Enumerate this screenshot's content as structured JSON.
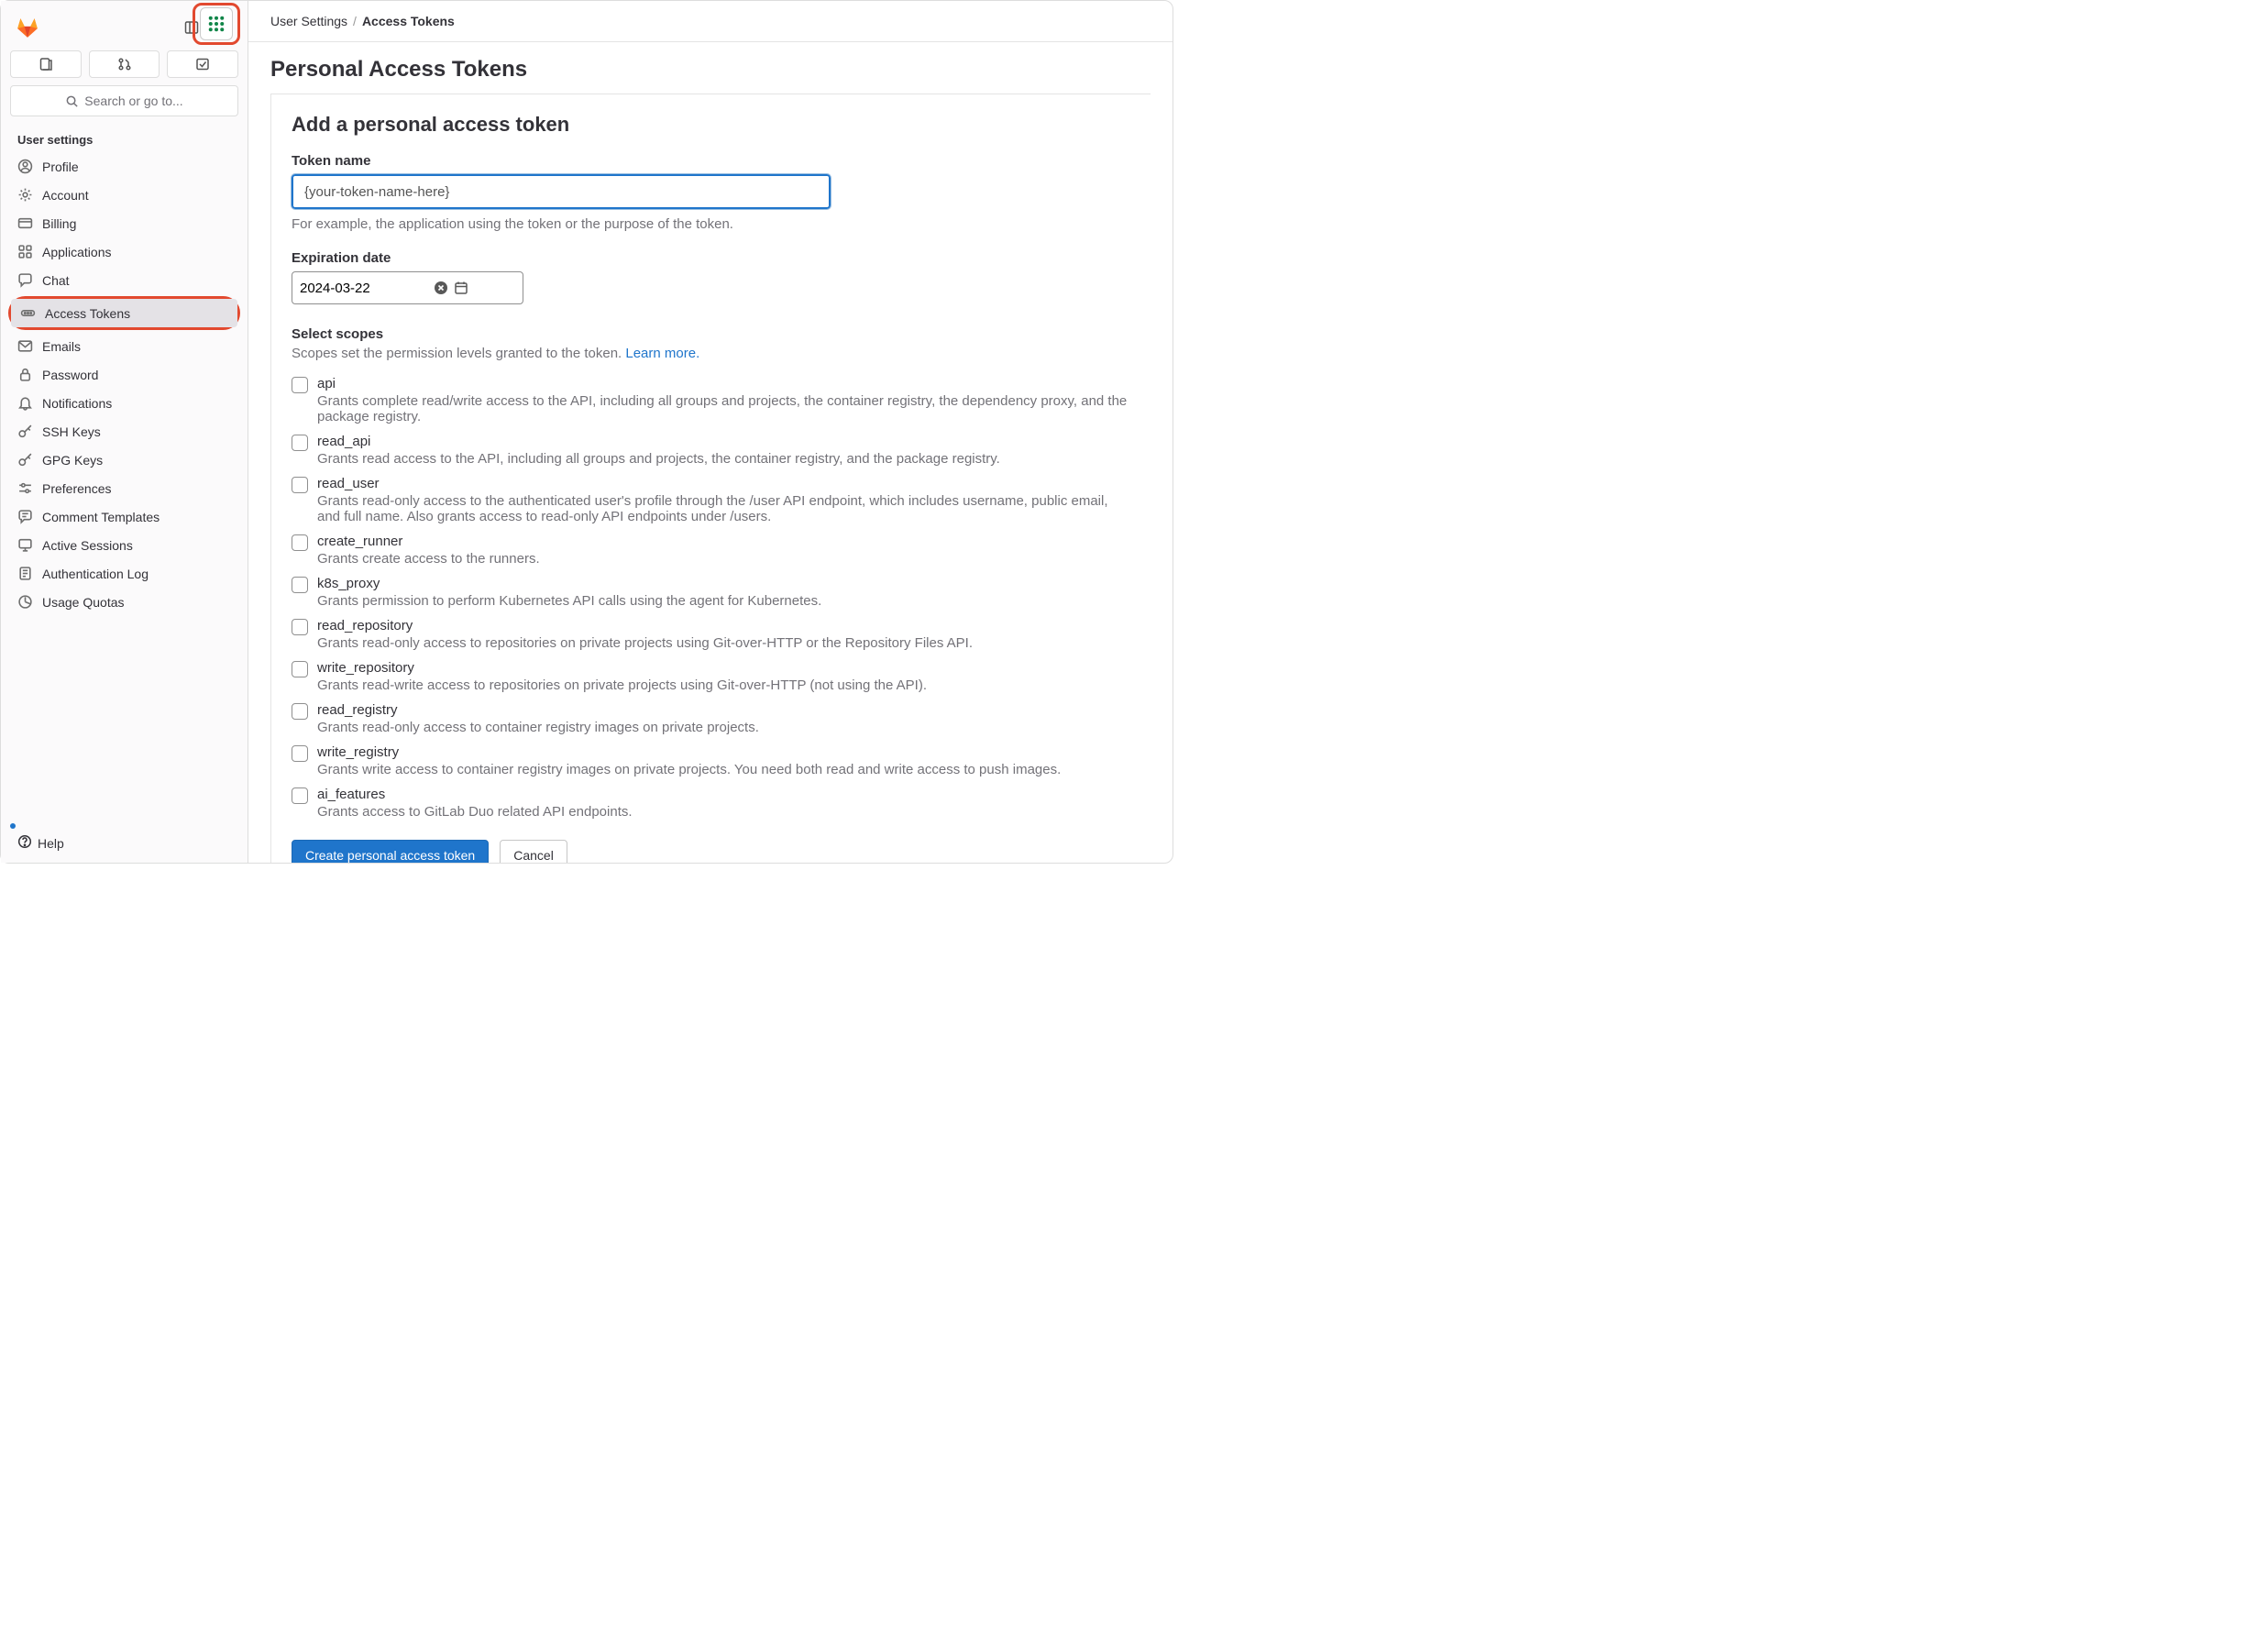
{
  "sidebar": {
    "search_placeholder": "Search or go to...",
    "section_label": "User settings",
    "nav_items": [
      {
        "label": "Profile",
        "icon": "profile-icon"
      },
      {
        "label": "Account",
        "icon": "gear-icon"
      },
      {
        "label": "Billing",
        "icon": "credit-card-icon"
      },
      {
        "label": "Applications",
        "icon": "applications-icon"
      },
      {
        "label": "Chat",
        "icon": "chat-icon"
      },
      {
        "label": "Access Tokens",
        "icon": "token-icon"
      },
      {
        "label": "Emails",
        "icon": "mail-icon"
      },
      {
        "label": "Password",
        "icon": "lock-icon"
      },
      {
        "label": "Notifications",
        "icon": "bell-icon"
      },
      {
        "label": "SSH Keys",
        "icon": "key-icon"
      },
      {
        "label": "GPG Keys",
        "icon": "key-icon"
      },
      {
        "label": "Preferences",
        "icon": "preferences-icon"
      },
      {
        "label": "Comment Templates",
        "icon": "comment-template-icon"
      },
      {
        "label": "Active Sessions",
        "icon": "monitor-icon"
      },
      {
        "label": "Authentication Log",
        "icon": "log-icon"
      },
      {
        "label": "Usage Quotas",
        "icon": "quota-icon"
      }
    ],
    "help_label": "Help"
  },
  "breadcrumb": {
    "root": "User Settings",
    "sep": "/",
    "current": "Access Tokens"
  },
  "page": {
    "title": "Personal Access Tokens",
    "form_heading": "Add a personal access token",
    "token_name_label": "Token name",
    "token_name_value": "{your-token-name-here}",
    "token_name_help": "For example, the application using the token or the purpose of the token.",
    "expiration_label": "Expiration date",
    "expiration_value": "2024-03-22",
    "scopes_label": "Select scopes",
    "scopes_help": "Scopes set the permission levels granted to the token. ",
    "scopes_learn_more": "Learn more.",
    "create_button": "Create personal access token",
    "cancel_button": "Cancel"
  },
  "scopes": [
    {
      "name": "api",
      "desc": "Grants complete read/write access to the API, including all groups and projects, the container registry, the dependency proxy, and the package registry."
    },
    {
      "name": "read_api",
      "desc": "Grants read access to the API, including all groups and projects, the container registry, and the package registry."
    },
    {
      "name": "read_user",
      "desc": "Grants read-only access to the authenticated user's profile through the /user API endpoint, which includes username, public email, and full name. Also grants access to read-only API endpoints under /users."
    },
    {
      "name": "create_runner",
      "desc": "Grants create access to the runners."
    },
    {
      "name": "k8s_proxy",
      "desc": "Grants permission to perform Kubernetes API calls using the agent for Kubernetes."
    },
    {
      "name": "read_repository",
      "desc": "Grants read-only access to repositories on private projects using Git-over-HTTP or the Repository Files API."
    },
    {
      "name": "write_repository",
      "desc": "Grants read-write access to repositories on private projects using Git-over-HTTP (not using the API)."
    },
    {
      "name": "read_registry",
      "desc": "Grants read-only access to container registry images on private projects."
    },
    {
      "name": "write_registry",
      "desc": "Grants write access to container registry images on private projects. You need both read and write access to push images."
    },
    {
      "name": "ai_features",
      "desc": "Grants access to GitLab Duo related API endpoints."
    }
  ]
}
